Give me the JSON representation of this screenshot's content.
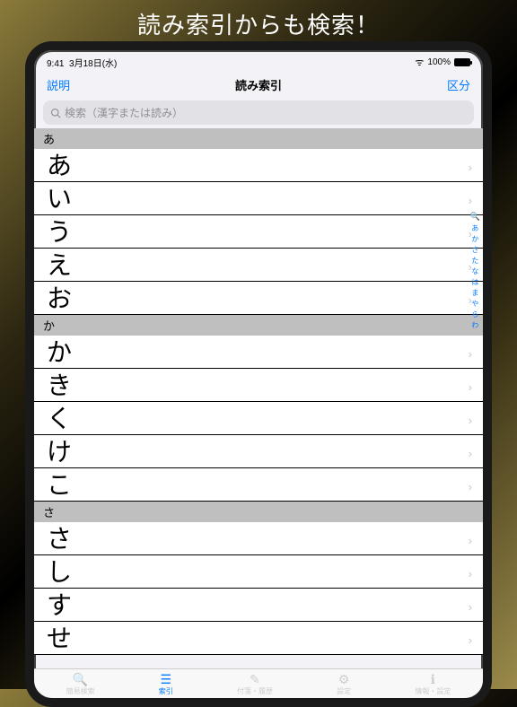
{
  "banner": "読み索引からも検索！",
  "status": {
    "time": "9:41",
    "date": "3月18日(水)",
    "battery": "100%"
  },
  "nav": {
    "left": "説明",
    "title": "読み索引",
    "right": "区分"
  },
  "search": {
    "placeholder": "検索（漢字または読み）"
  },
  "sections": [
    {
      "header": "あ",
      "rows": [
        "あ",
        "い",
        "う",
        "え",
        "お"
      ]
    },
    {
      "header": "か",
      "rows": [
        "か",
        "き",
        "く",
        "け",
        "こ"
      ]
    },
    {
      "header": "さ",
      "rows": [
        "さ",
        "し",
        "す",
        "せ"
      ]
    }
  ],
  "index_bar": [
    "あ",
    "か",
    "さ",
    "た",
    "な",
    "は",
    "ま",
    "や",
    "ら",
    "わ"
  ],
  "tabs": [
    {
      "icon": "🔍",
      "label": "簡易検索",
      "active": false
    },
    {
      "icon": "☰",
      "label": "索引",
      "active": true
    },
    {
      "icon": "✎",
      "label": "付箋・履歴",
      "active": false
    },
    {
      "icon": "⚙",
      "label": "設定",
      "active": false
    },
    {
      "icon": "ℹ",
      "label": "情報・設定",
      "active": false
    }
  ]
}
